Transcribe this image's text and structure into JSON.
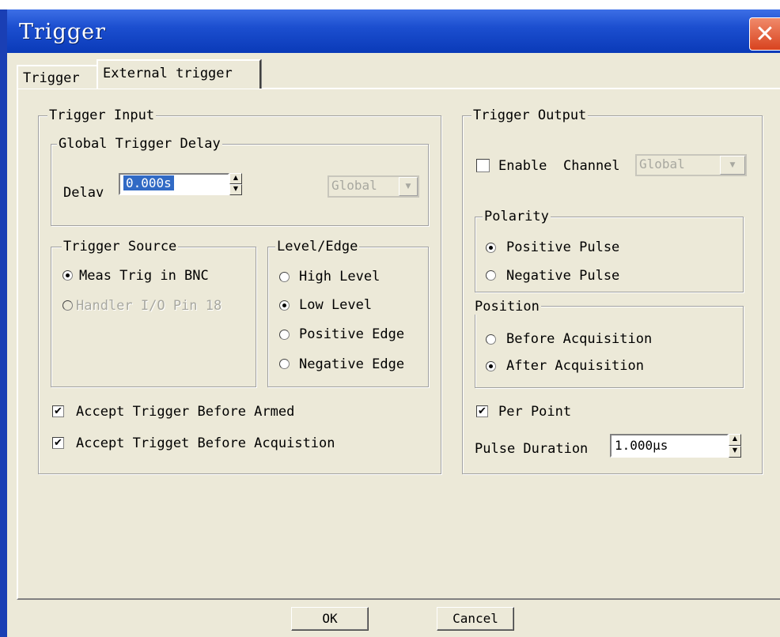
{
  "window": {
    "title": "Trigger",
    "close_symbol": "✕"
  },
  "tabs": [
    {
      "label": "Trigger",
      "active": false
    },
    {
      "label": "External trigger",
      "active": true
    }
  ],
  "trigger_input": {
    "title": "Trigger Input",
    "global_delay": {
      "title": "Global Trigger Delay",
      "delay_label": "Delav",
      "delay_value": "0.000s",
      "scope_select": "Global"
    },
    "trigger_source": {
      "title": "Trigger Source",
      "options": [
        {
          "label": "Meas Trig in BNC",
          "selected": true,
          "enabled": true
        },
        {
          "label": "Handler I/O Pin 18",
          "selected": false,
          "enabled": false
        }
      ]
    },
    "level_edge": {
      "title": "Level/Edge",
      "options": [
        {
          "label": "High Level",
          "selected": false
        },
        {
          "label": "Low Level",
          "selected": true
        },
        {
          "label": "Positive Edge",
          "selected": false
        },
        {
          "label": "Negative Edge",
          "selected": false
        }
      ]
    },
    "accept_before_armed": {
      "label": "Accept Trigger Before Armed",
      "checked": true
    },
    "accept_before_acquisition": {
      "label": "Accept Trigget Before Acquistion",
      "checked": true
    }
  },
  "trigger_output": {
    "title": "Trigger Output",
    "enable": {
      "label": "Enable",
      "checked": false
    },
    "channel_label": "Channel",
    "channel_select": "Global",
    "polarity": {
      "title": "Polarity",
      "options": [
        {
          "label": "Positive Pulse",
          "selected": true
        },
        {
          "label": "Negative Pulse",
          "selected": false
        }
      ]
    },
    "position": {
      "title": "Position",
      "options": [
        {
          "label": "Before Acquisition",
          "selected": false
        },
        {
          "label": "After Acquisition",
          "selected": true
        }
      ]
    },
    "per_point": {
      "label": "Per Point",
      "checked": true
    },
    "pulse_duration_label": "Pulse Duration",
    "pulse_duration_value": "1.000μs"
  },
  "buttons": {
    "ok": "OK",
    "cancel": "Cancel"
  },
  "symbols": {
    "check": "✔",
    "spin_up": "▲",
    "spin_down": "▼",
    "dropdown": "▼"
  },
  "colors": {
    "titlebar": "#0a3ab8",
    "selection": "#316ac5",
    "close": "#d8431f",
    "dialog_bg": "#ece9d8"
  }
}
